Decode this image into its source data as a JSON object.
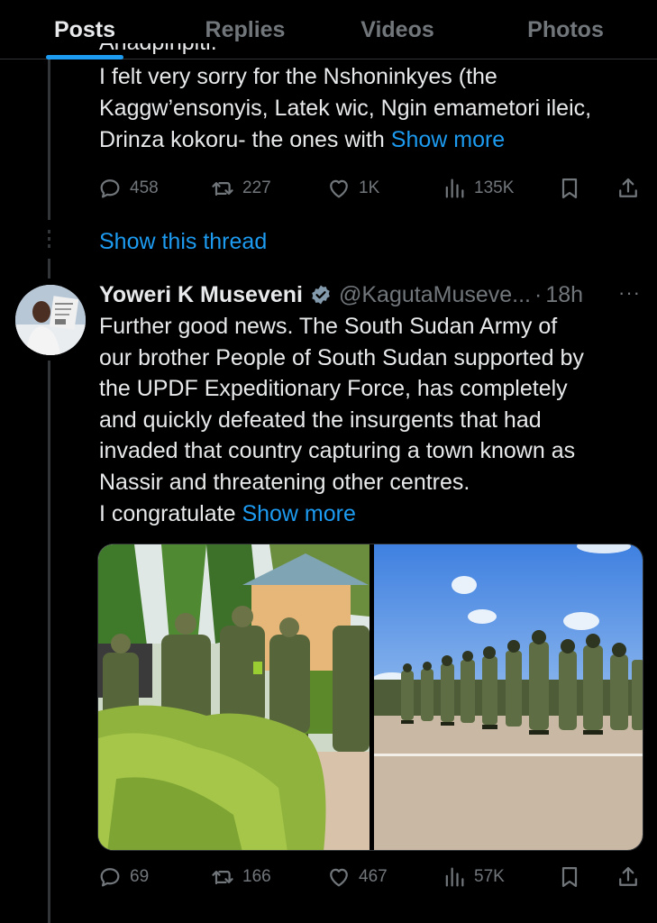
{
  "tabs": [
    {
      "label": "Posts",
      "active": true
    },
    {
      "label": "Replies",
      "active": false
    },
    {
      "label": "Videos",
      "active": false
    },
    {
      "label": "Photos",
      "active": false
    }
  ],
  "prev_tweet": {
    "cut_off_text": "Ahadpinpiti.",
    "lines": [
      "I felt very sorry for the Nshoninkyes (the",
      "Kaggw’ensonyis, Latek wic, Ngin emametori ileic,",
      "Drinza kokoru- the ones with "
    ],
    "show_more": "Show more",
    "stats": {
      "replies": "458",
      "reposts": "227",
      "likes": "1K",
      "views": "135K"
    },
    "show_thread": "Show this thread"
  },
  "tweet": {
    "name": "Yoweri K Museveni",
    "handle": "@KagutaMuseve...",
    "sep": "·",
    "time": "18h",
    "more": "···",
    "lines": [
      "Further good news. The South Sudan Army of",
      "our brother People of South Sudan supported by",
      "the UPDF Expeditionary Force, has completely",
      "and quickly defeated the insurgents that had",
      "invaded that country capturing a town known as",
      "Nassir and threatening other centres.",
      "I congratulate "
    ],
    "show_more": "Show more",
    "stats": {
      "replies": "69",
      "reposts": "166",
      "likes": "467",
      "views": "57K"
    }
  },
  "colors": {
    "accent": "#1d9bf0",
    "muted": "#71767b",
    "text": "#e7e9ea",
    "bg": "#000000"
  },
  "icons": [
    "reply-icon",
    "repost-icon",
    "like-icon",
    "views-icon",
    "bookmark-icon",
    "share-icon",
    "verified-badge-icon"
  ]
}
